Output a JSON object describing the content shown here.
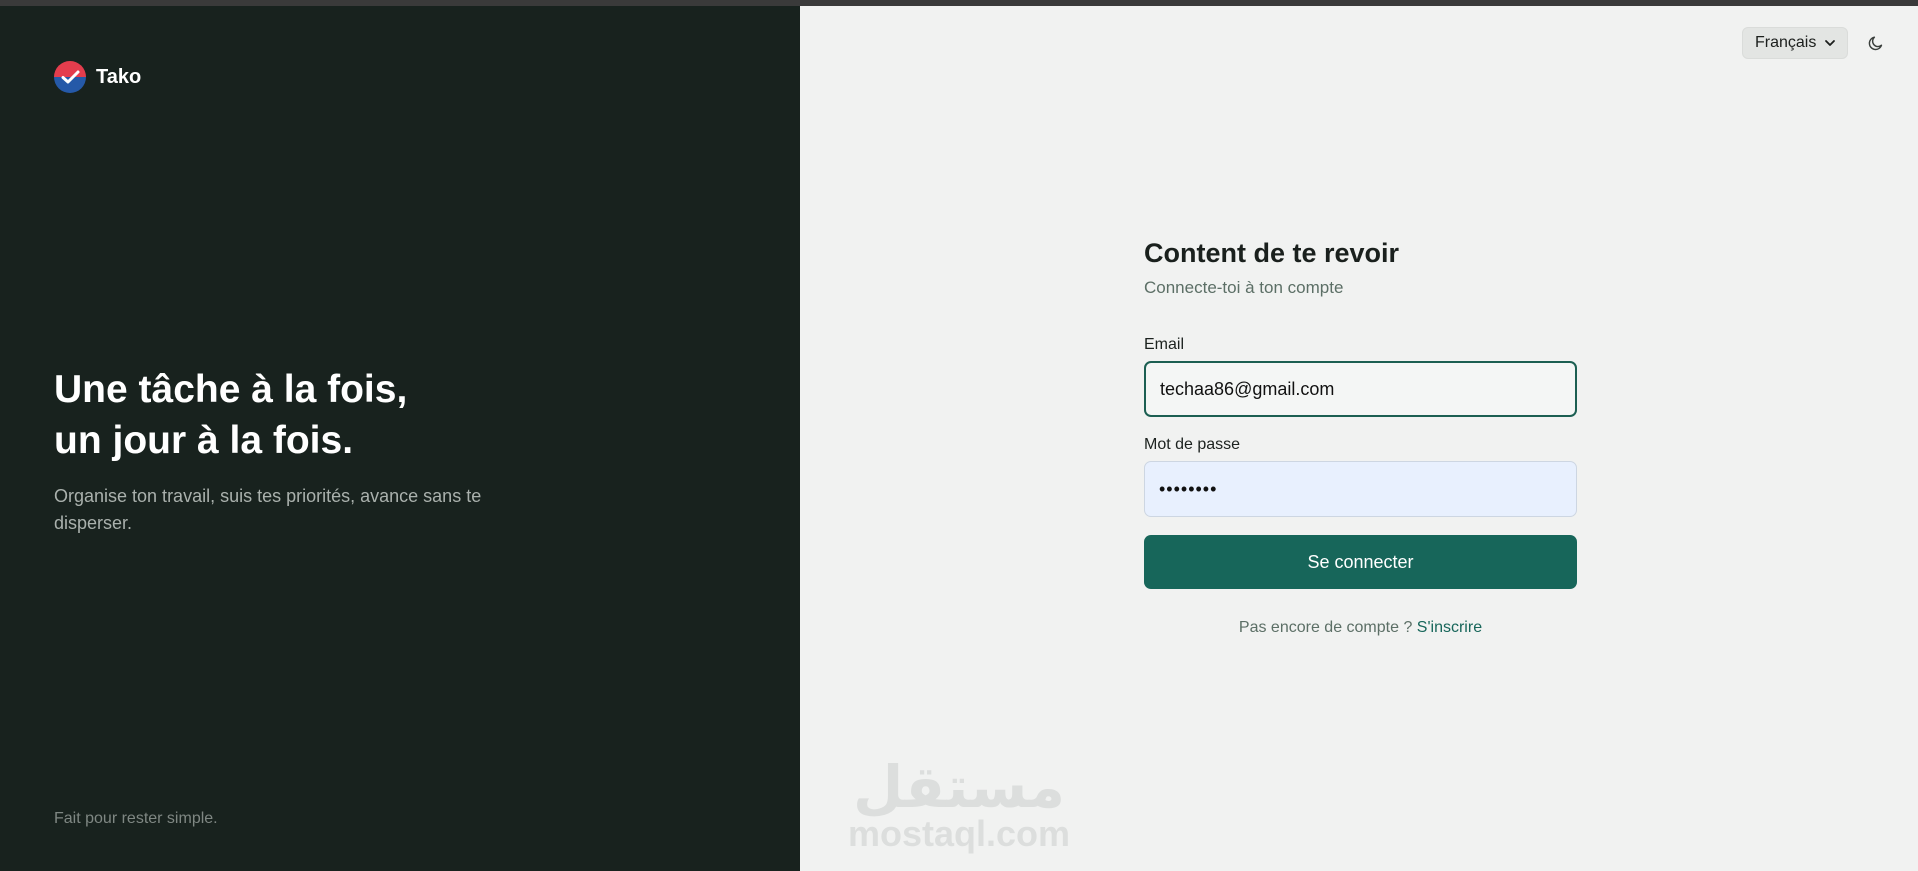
{
  "brand": {
    "name": "Tako",
    "colors": {
      "logo_red": "#e43d4d",
      "logo_blue": "#2559a8",
      "panel_dark": "#18221e",
      "accent_green": "#17665a"
    }
  },
  "hero": {
    "headline_line1": "Une tâche à la fois,",
    "headline_line2": "un jour à la fois.",
    "tagline": "Organise ton travail, suis tes priorités, avance sans te disperser.",
    "footer": "Fait pour rester simple."
  },
  "header": {
    "language": {
      "selected": "Français",
      "icon": "chevron-down-icon"
    },
    "theme_icon": "moon-icon"
  },
  "login": {
    "title": "Content de te revoir",
    "subtitle": "Connecte-toi à ton compte",
    "email_label": "Email",
    "email_value": "techaa86@gmail.com",
    "password_label": "Mot de passe",
    "password_value": "••••••••",
    "submit_label": "Se connecter",
    "signup_prompt": "Pas encore de compte ?",
    "signup_link": "S'inscrire"
  },
  "watermark": {
    "arabic": "مستقل",
    "latin": "mostaql.com"
  }
}
